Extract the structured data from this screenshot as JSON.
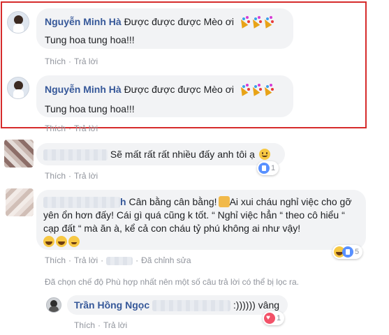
{
  "comments": [
    {
      "author": "Nguyễn Minh Hà",
      "text_line1": "Được được được Mèo ơi",
      "text_line2": "Tung hoa tung hoa!!!",
      "like": "Thích",
      "reply": "Trả lời"
    },
    {
      "author": "Nguyễn Minh Hà",
      "text_line1": "Được được được Mèo ơi",
      "text_line2": "Tung hoa tung hoa!!!",
      "like": "Thích",
      "reply": "Trả lời"
    },
    {
      "text": "Sẽ mất rất rất nhiều đấy anh tôi ạ",
      "like": "Thích",
      "reply": "Trả lời",
      "reaction_count": "1"
    },
    {
      "name_suffix": "h",
      "line1": "Cân bằng cân bằng!",
      "line1b": "Ai xui cháu nghỉ việc cho gỡ",
      "line2": "yên ổn hơn đấy! Cái gì quá cũng k tốt. “ Nghỉ việc hẳn “ theo cô hiểu “",
      "line3": "cạp đất “ mà ăn à, kể cả con cháu tỷ phú không ai như vậy!",
      "like": "Thích",
      "reply": "Trả lời",
      "edited": "Đã chỉnh sửa",
      "reaction_count": "5"
    }
  ],
  "filter_notice": "Đã chọn chế độ Phù hợp nhất nên một số câu trả lời có thể bị lọc ra.",
  "reply": {
    "author": "Trần Hồng Ngọc",
    "text": ":)))))) vâng",
    "like": "Thích",
    "reply": "Trả lời",
    "reaction_count": "1"
  },
  "colors": {
    "name": "#365899",
    "meta": "#90949c",
    "bubble": "#f2f3f5",
    "highlight": "#d62b2b",
    "like_blue": "#5890ff",
    "love_red": "#f25268",
    "haha_yellow": "#f7c843"
  },
  "icons": {
    "party": "party-popper-icon",
    "smile": "smile-emoji-icon",
    "thumbs": "thumbs-up-emoji-icon",
    "laugh": "laughing-emoji-icon",
    "like": "like-reaction-icon",
    "haha": "haha-reaction-icon",
    "love": "love-reaction-icon"
  }
}
